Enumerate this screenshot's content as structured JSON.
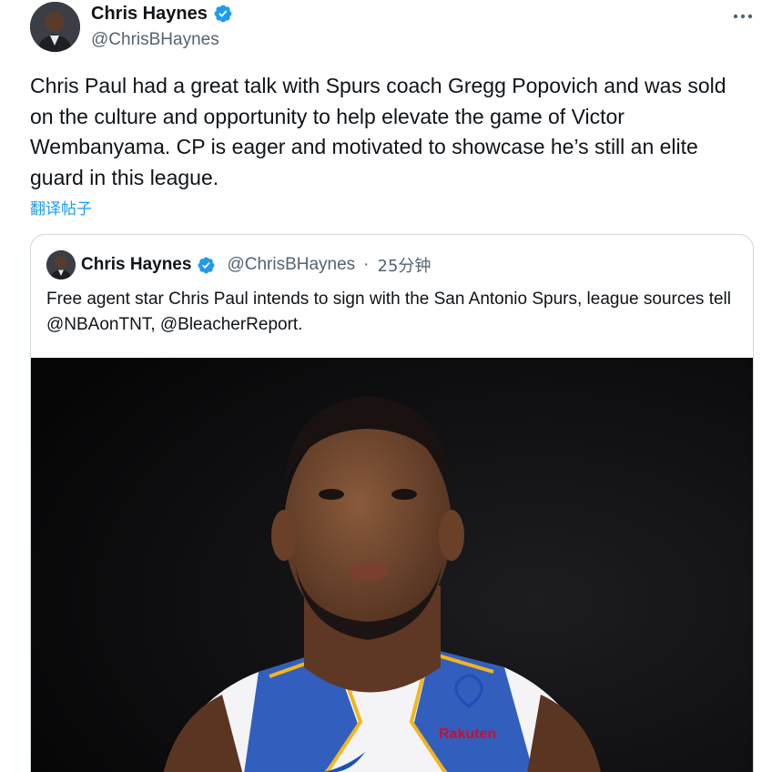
{
  "tweet": {
    "author_name": "Chris Haynes",
    "author_handle": "@ChrisBHaynes",
    "more_icon": "more-horizontal-icon",
    "verified_icon": "verified-badge-icon",
    "text": "Chris Paul had a great talk with Spurs coach Gregg Popovich and was sold on the culture and opportunity to help elevate the game of Victor Wembanyama. CP is eager and motivated to showcase he’s still an elite guard in this league.",
    "translate_label": "翻译帖子"
  },
  "quote": {
    "author_name": "Chris Haynes",
    "author_handle": "@ChrisBHaynes",
    "separator": "·",
    "time": "25分钟",
    "text": "Free agent star Chris Paul intends to sign with the San Antonio Spurs, league sources tell @NBAonTNT, @BleacherReport.",
    "image": {
      "description_icon": "player-photo",
      "jersey_sponsor": "Rakuten"
    }
  },
  "colors": {
    "text": "#0f1419",
    "secondary": "#536471",
    "link": "#1d9bf0",
    "verified": "#1d9bf0",
    "border": "#cfd9de"
  }
}
